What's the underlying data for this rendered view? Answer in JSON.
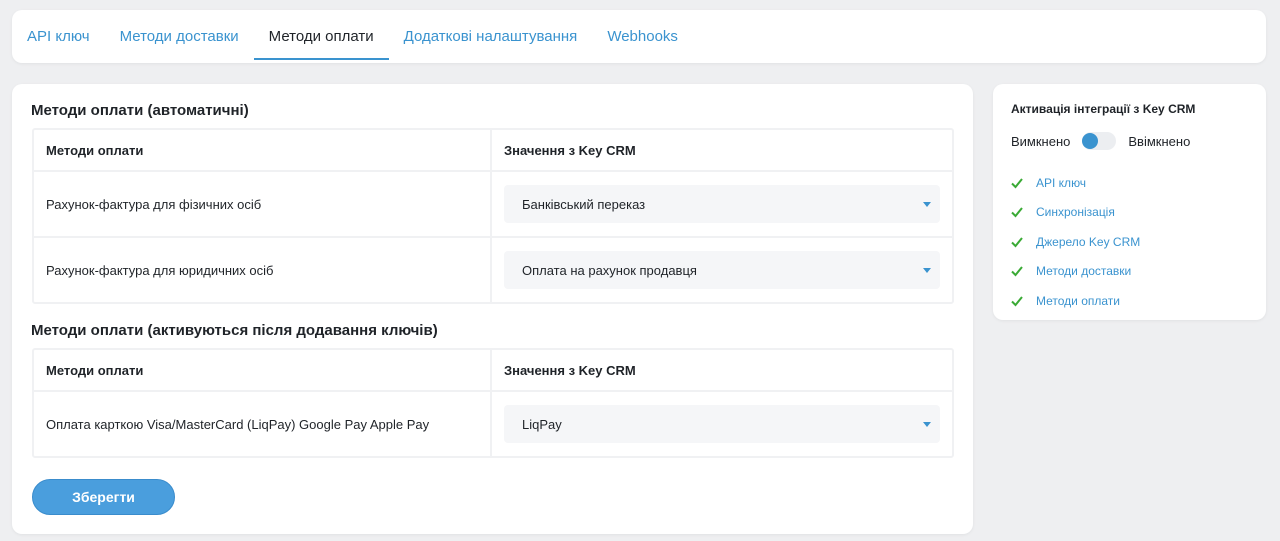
{
  "tabs": [
    {
      "label": "API ключ",
      "active": false
    },
    {
      "label": "Методи доставки",
      "active": false
    },
    {
      "label": "Методи оплати",
      "active": true
    },
    {
      "label": "Додаткові налаштування",
      "active": false
    },
    {
      "label": "Webhooks",
      "active": false
    }
  ],
  "auto_section": {
    "title": "Методи оплати (автоматичні)",
    "col1_header": "Методи оплати",
    "col2_header": "Значення з Key CRM",
    "rows": [
      {
        "method": "Рахунок-фактура для фізичних осіб",
        "value": "Банківський переказ"
      },
      {
        "method": "Рахунок-фактура для юридичних осіб",
        "value": "Оплата на рахунок продавця"
      }
    ]
  },
  "keys_section": {
    "title": "Методи оплати (активуються після додавання ключів)",
    "col1_header": "Методи оплати",
    "col2_header": "Значення з Key CRM",
    "rows": [
      {
        "method": "Оплата карткою Visa/MasterCard (LiqPay) Google Pay Apple Pay",
        "value": "LiqPay"
      }
    ]
  },
  "save_label": "Зберегти",
  "sidebar": {
    "title": "Активація інтеграції з Key CRM",
    "off_label": "Вимкнено",
    "on_label": "Ввімкнено",
    "checklist": [
      "API ключ",
      "Синхронізація",
      "Джерело Key CRM",
      "Методи доставки",
      "Методи оплати"
    ]
  },
  "colors": {
    "accent": "#3a93cf",
    "check": "#3aaa35",
    "button": "#4a9edd"
  }
}
